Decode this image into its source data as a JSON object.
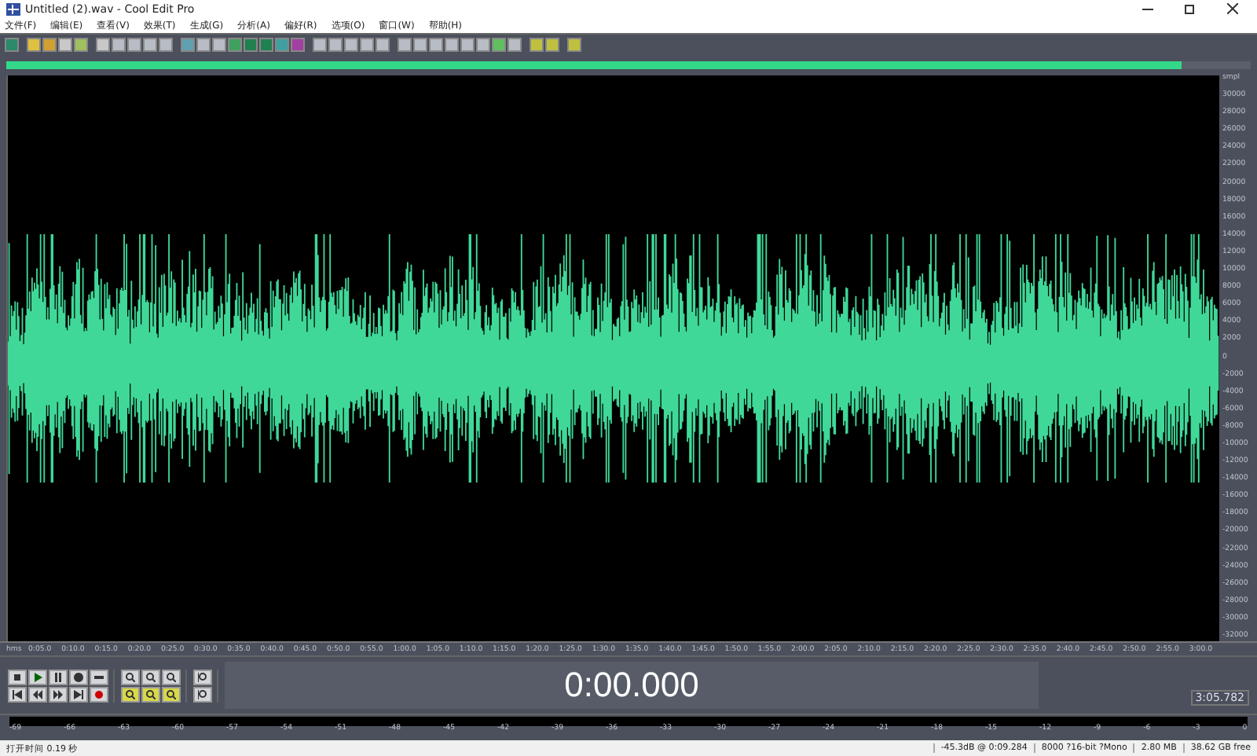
{
  "window": {
    "title": "Untitled (2).wav - Cool Edit Pro"
  },
  "menu": [
    "文件(F)",
    "编辑(E)",
    "查看(V)",
    "效果(T)",
    "生成(G)",
    "分析(A)",
    "偏好(R)",
    "选项(O)",
    "窗口(W)",
    "帮助(H)"
  ],
  "overview": {
    "level": 0.945
  },
  "amplitude_axis": {
    "unit": "smpl",
    "ticks": [
      "30000",
      "28000",
      "26000",
      "24000",
      "22000",
      "20000",
      "18000",
      "16000",
      "14000",
      "12000",
      "10000",
      "8000",
      "6000",
      "4000",
      "2000",
      "0",
      "-2000",
      "-4000",
      "-6000",
      "-8000",
      "-10000",
      "-12000",
      "-14000",
      "-16000",
      "-18000",
      "-20000",
      "-22000",
      "-24000",
      "-26000",
      "-28000",
      "-30000",
      "-32000"
    ]
  },
  "time_ruler": {
    "unit": "hms",
    "ticks": [
      "0:05.0",
      "0:10.0",
      "0:15.0",
      "0:20.0",
      "0:25.0",
      "0:30.0",
      "0:35.0",
      "0:40.0",
      "0:45.0",
      "0:50.0",
      "0:55.0",
      "1:00.0",
      "1:05.0",
      "1:10.0",
      "1:15.0",
      "1:20.0",
      "1:25.0",
      "1:30.0",
      "1:35.0",
      "1:40.0",
      "1:45.0",
      "1:50.0",
      "1:55.0",
      "2:00.0",
      "2:05.0",
      "2:10.0",
      "2:15.0",
      "2:20.0",
      "2:25.0",
      "2:30.0",
      "2:35.0",
      "2:40.0",
      "2:45.0",
      "2:50.0",
      "2:55.0",
      "3:00.0"
    ]
  },
  "time_display": "0:00.000",
  "selection": {
    "length": "3:05.782"
  },
  "meter": {
    "ticks": [
      "-69",
      "-66",
      "-63",
      "-60",
      "-57",
      "-54",
      "-51",
      "-48",
      "-45",
      "-42",
      "-39",
      "-36",
      "-33",
      "-30",
      "-27",
      "-24",
      "-21",
      "-18",
      "-15",
      "-12",
      "-9",
      "-6",
      "-3",
      "0"
    ]
  },
  "status_bar": [
    "打开时间 0.19 秒",
    "-45.3dB @ 0:09.284",
    "8000 ?16-bit ?Mono",
    "2.80 MB",
    "38.62 GB free"
  ]
}
